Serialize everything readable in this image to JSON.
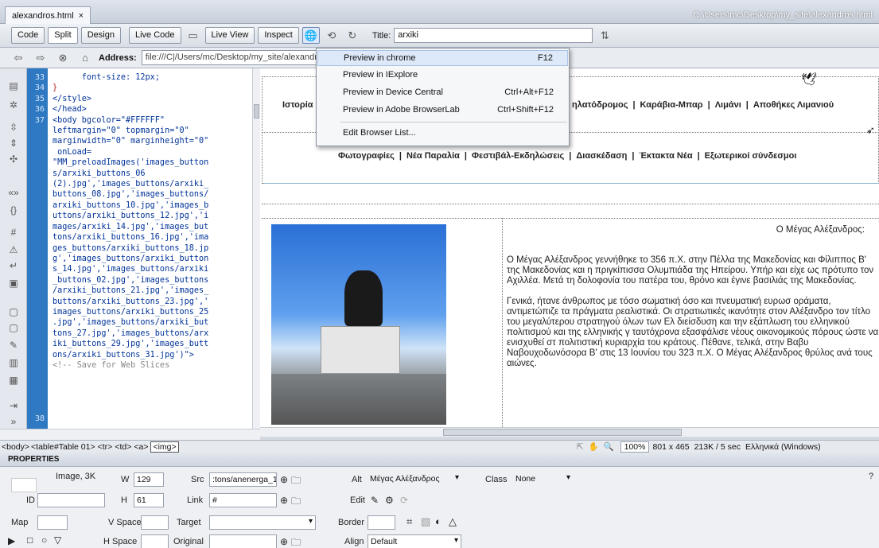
{
  "window": {
    "tab_label": "alexandros.html",
    "file_path": "C:\\Users\\mc\\Desktop\\my_site\\alexandros.html"
  },
  "toolbar": {
    "code": "Code",
    "split": "Split",
    "design": "Design",
    "live_code": "Live Code",
    "live_view": "Live View",
    "inspect": "Inspect",
    "title_label": "Title:",
    "title_value": "arxiki"
  },
  "address": {
    "label": "Address:",
    "value": "file:///C|/Users/mc/Desktop/my_site/alexandros.h"
  },
  "preview_menu": {
    "items": [
      {
        "label": "Preview in chrome",
        "shortcut": "F12"
      },
      {
        "label": "Preview in IExplore",
        "shortcut": ""
      },
      {
        "label": "Preview in Device Central",
        "shortcut": "Ctrl+Alt+F12"
      },
      {
        "label": "Preview in Adobe BrowserLab",
        "shortcut": "Ctrl+Shift+F12"
      },
      {
        "label": "Edit Browser List...",
        "shortcut": ""
      }
    ]
  },
  "code": {
    "line_numbers": [
      "33",
      "34",
      "35",
      "36",
      "37",
      "38"
    ],
    "lines": [
      "      font-size: 12px;",
      "}",
      "</style>",
      "</head>",
      "<body bgcolor=\"#FFFFFF\"",
      "leftmargin=\"0\" topmargin=\"0\"",
      "marginwidth=\"0\" marginheight=\"0\"",
      " onLoad=",
      "\"MM_preloadImages('images_button",
      "s/arxiki_buttons_06",
      "(2).jpg','images_buttons/arxiki_",
      "buttons_08.jpg','images_buttons/",
      "arxiki_buttons_10.jpg','images_b",
      "uttons/arxiki_buttons_12.jpg','i",
      "mages/arxiki_14.jpg','images_but",
      "tons/arxiki_buttons_16.jpg','ima",
      "ges_buttons/arxiki_buttons_18.jp",
      "g','images_buttons/arxiki_button",
      "s_14.jpg','images_buttons/arxiki",
      "_buttons_02.jpg','images_buttons",
      "/arxiki_buttons_21.jpg','images_",
      "buttons/arxiki_buttons_23.jpg','",
      "images_buttons/arxiki_buttons_25",
      ".jpg','images_buttons/arxiki_but",
      "tons_27.jpg','images_buttons/arx",
      "iki_buttons_29.jpg','images_butt",
      "ons/arxiki_buttons_31.jpg')\">",
      "<!-- Save for Web Slices"
    ]
  },
  "design": {
    "nav_row1": [
      "Ιστορία Γ",
      "ηλατόδρομος",
      "|",
      "Καράβια-Μπαρ",
      "|",
      "Λιμάνι",
      "|",
      "Αποθήκες Λιμανιού"
    ],
    "nav_row2": [
      "Φωτογραφίες",
      "|",
      "Νέα Παραλία",
      "|",
      "Φεστιβάλ-Εκδηλώσεις",
      "|",
      "Διασκέδαση",
      "|",
      "Έκτακτα Νέα",
      "|",
      "Εξωτερικοί σύνδεσμοι"
    ],
    "article_title": "Ο Μέγας Αλέξανδρος:",
    "para1": "Ο Μέγας Αλέξανδρος γεννήθηκε το 356 π.Χ. στην Πέλλα της Μακεδονίας και Φίλιππος Β' της Μακεδονίας και η πριγκίπισσα Ολυμπιάδα της Ηπείρου. Υπήρ και είχε ως πρότυπο τον Αχιλλέα. Μετά τη δολοφονία του πατέρα του, θρόνο και έγινε βασιλιάς της Μακεδονίας.",
    "para2": "Γενικά, ήτανε άνθρωπος με τόσο σωματική όσο και πνευματική ευρωσ οράματα, αντιμετώπιζε τα πράγματα ρεαλιστικά. Οι στρατιωτικές ικανότητε στον Αλέξανδρο τον τίτλο του μεγαλύτερου στρατηγού όλων των Ελ διείσδυση και την εξάπλωση του ελληνικού πολιτισμού και της ελληνικής γ ταυτόχρονα εξασφάλισε νέους οικονομικούς πόρους ώστε να ενισχυθεί στ πολιτιστική κυριαρχία του κράτους. Πέθανε, τελικά, στην Βαβυ Ναβουχοδωνόσορα Β' στις 13 Ιουνίου του 323 π.Χ. Ο Μέγας Αλέξανδρος θρύλος ανά τους αιώνες."
  },
  "status": {
    "tags": [
      "<body>",
      "<table#Table 01>",
      "<tr>",
      "<td>",
      "<a>",
      "<img>"
    ],
    "zoom": "100%",
    "size": "801 x 465",
    "download": "213K / 5 sec",
    "encoding": "Ελληνικά (Windows)"
  },
  "properties": {
    "header": "PROPERTIES",
    "image_label": "Image, 3K",
    "w_label": "W",
    "w_value": "129",
    "h_label": "H",
    "h_value": "61",
    "id_label": "ID",
    "src_label": "Src",
    "src_value": ":tons/anenerga_10.jpg",
    "link_label": "Link",
    "link_value": "#",
    "alt_label": "Alt",
    "alt_value": "Μέγας Αλέξανδρος",
    "edit_label": "Edit",
    "class_label": "Class",
    "class_value": "None",
    "map_label": "Map",
    "vspace_label": "V Space",
    "hspace_label": "H Space",
    "target_label": "Target",
    "original_label": "Original",
    "border_label": "Border",
    "align_label": "Align",
    "align_value": "Default"
  }
}
